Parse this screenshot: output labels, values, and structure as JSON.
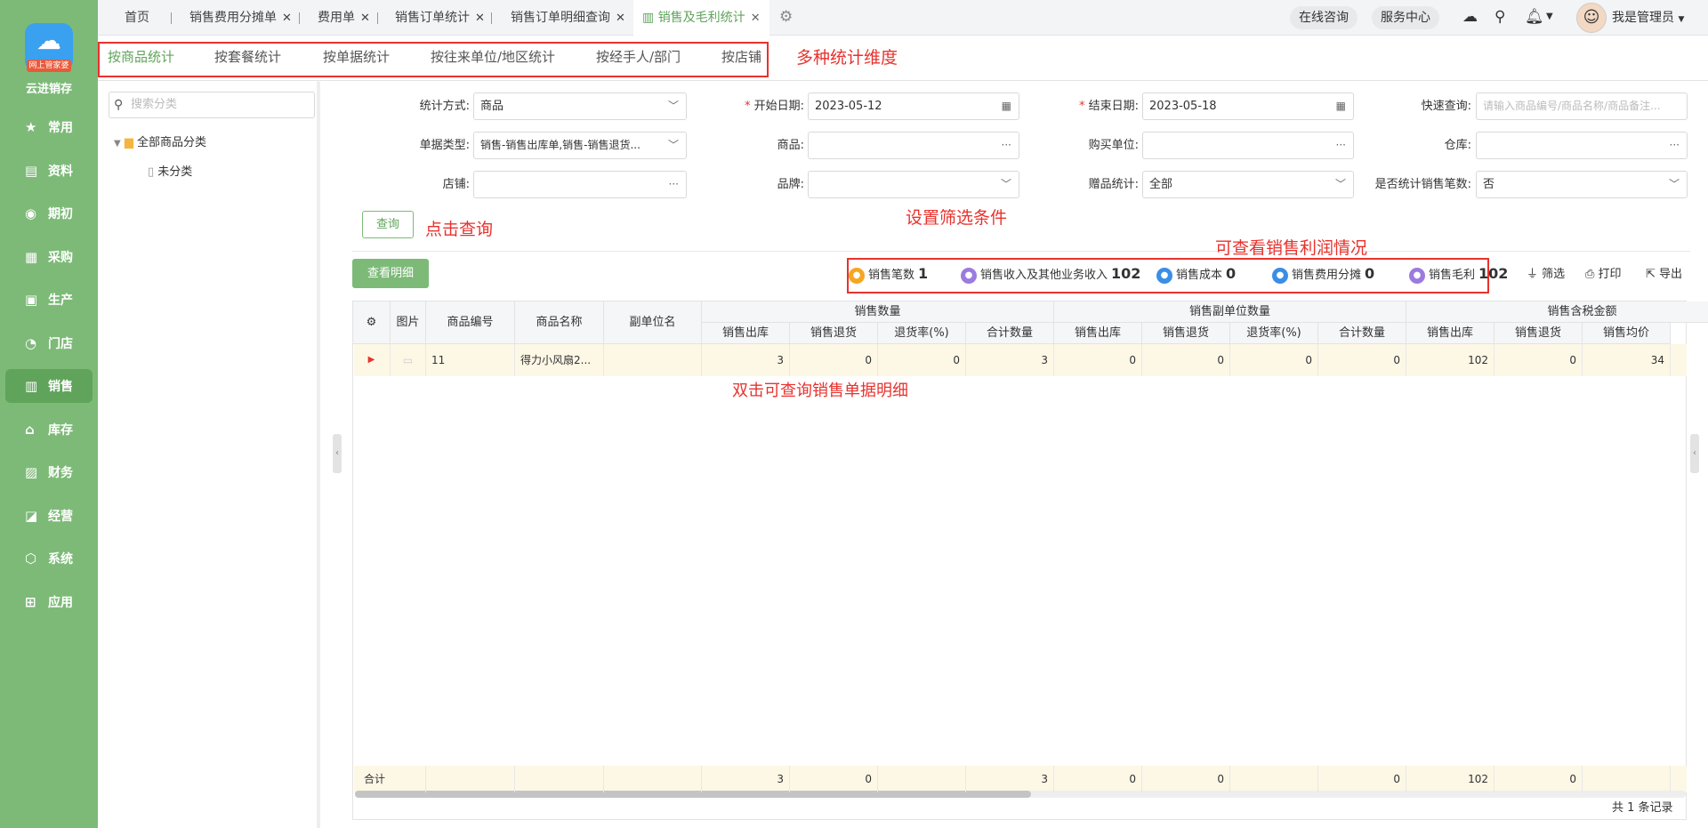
{
  "brand": {
    "name": "云进销存",
    "badge": "网上管家婆"
  },
  "sidebar": {
    "items": [
      {
        "label": "常用",
        "icon": "star-icon",
        "glyph": "★"
      },
      {
        "label": "资料",
        "icon": "profile-icon",
        "glyph": "▤"
      },
      {
        "label": "期初",
        "icon": "clock-icon",
        "glyph": "◉"
      },
      {
        "label": "采购",
        "icon": "purchase-icon",
        "glyph": "▦"
      },
      {
        "label": "生产",
        "icon": "production-icon",
        "glyph": "▣"
      },
      {
        "label": "门店",
        "icon": "store-icon",
        "glyph": "◔"
      },
      {
        "label": "销售",
        "icon": "sales-icon",
        "glyph": "▥"
      },
      {
        "label": "库存",
        "icon": "warehouse-icon",
        "glyph": "⌂"
      },
      {
        "label": "财务",
        "icon": "finance-icon",
        "glyph": "▨"
      },
      {
        "label": "经营",
        "icon": "chart-icon",
        "glyph": "◪"
      },
      {
        "label": "系统",
        "icon": "system-icon",
        "glyph": "⬡"
      },
      {
        "label": "应用",
        "icon": "app-icon",
        "glyph": "⊞"
      }
    ],
    "active_index": 6
  },
  "tabs": [
    {
      "label": "首页"
    },
    {
      "label": "销售费用分摊单"
    },
    {
      "label": "费用单"
    },
    {
      "label": "销售订单统计"
    },
    {
      "label": "销售订单明细查询"
    },
    {
      "label": "销售及毛利统计"
    }
  ],
  "topright": {
    "consult": "在线咨询",
    "service": "服务中心",
    "user": "我是管理员"
  },
  "subtabs": [
    "按商品统计",
    "按套餐统计",
    "按单据统计",
    "按往来单位/地区统计",
    "按经手人/部门",
    "按店铺"
  ],
  "annotations": {
    "dimensions": "多种统计维度",
    "filters": "设置筛选条件",
    "query": "点击查询",
    "profit": "可查看销售利润情况",
    "dblclick": "双击可查询销售单据明细"
  },
  "category": {
    "search_placeholder": "搜索分类",
    "root": "全部商品分类",
    "child": "未分类"
  },
  "filters": {
    "stat_mode": {
      "label": "统计方式:",
      "value": "商品"
    },
    "start_date": {
      "label": "开始日期:",
      "value": "2023-05-12"
    },
    "end_date": {
      "label": "结束日期:",
      "value": "2023-05-18"
    },
    "quick": {
      "label": "快速查询:",
      "placeholder": "请输入商品编号/商品名称/商品备注..."
    },
    "doc_type": {
      "label": "单据类型:",
      "value": "销售-销售出库单,销售-销售退货..."
    },
    "goods": {
      "label": "商品:"
    },
    "buyer": {
      "label": "购买单位:"
    },
    "warehouse": {
      "label": "仓库:"
    },
    "shop": {
      "label": "店铺:"
    },
    "brand": {
      "label": "品牌:"
    },
    "gift": {
      "label": "赠品统计:",
      "value": "全部"
    },
    "count_sales": {
      "label": "是否统计销售笔数:",
      "value": "否"
    }
  },
  "buttons": {
    "query": "查询",
    "detail": "查看明细",
    "filter": "筛选",
    "print": "打印",
    "export": "导出"
  },
  "stats": [
    {
      "label": "销售笔数",
      "value": "1",
      "color": "#f5a623"
    },
    {
      "label": "销售收入及其他业务收入",
      "value": "102",
      "color": "#9b7be0"
    },
    {
      "label": "销售成本",
      "value": "0",
      "color": "#3a8ee6"
    },
    {
      "label": "销售费用分摊",
      "value": "0",
      "color": "#3a8ee6"
    },
    {
      "label": "销售毛利",
      "value": "102",
      "color": "#9b7be0"
    }
  ],
  "table": {
    "fixed_headers": [
      "图片",
      "商品编号",
      "商品名称",
      "副单位名"
    ],
    "groups": [
      "销售数量",
      "销售副单位数量",
      "销售含税金额"
    ],
    "sub_headers": [
      "销售出库",
      "销售退货",
      "退货率(%)",
      "合计数量",
      "销售出库",
      "销售退货",
      "退货率(%)",
      "合计数量",
      "销售出库",
      "销售退货",
      "销售均价"
    ],
    "row": {
      "code": "11",
      "name": "得力小风扇2...",
      "unit": "",
      "values": [
        "3",
        "0",
        "0",
        "3",
        "0",
        "0",
        "0",
        "0",
        "102",
        "0",
        "34"
      ]
    },
    "footer": {
      "label": "合计",
      "values": [
        "3",
        "0",
        "",
        "3",
        "0",
        "0",
        "",
        "0",
        "102",
        "0",
        ""
      ]
    }
  },
  "total_records": "共 1 条记录",
  "colors": {
    "sidebar": "#7dba78",
    "accent": "#5fa45a",
    "annotation": "#e8322d",
    "row_highlight": "#fdf7e6"
  }
}
